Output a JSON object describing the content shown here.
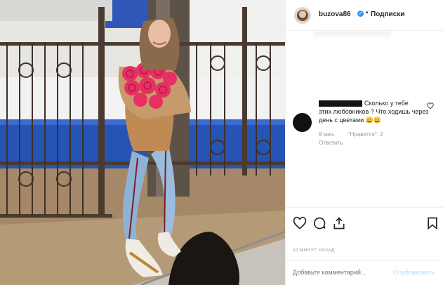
{
  "header": {
    "username": "buzova86",
    "follow_label": "Подписки",
    "separator": "•"
  },
  "comment": {
    "text_line1": "Сколько у тебе",
    "text_rest": "этих любовников ? Что ходишь через день с цветами 😄😄",
    "time": "9 мин.",
    "likes": "\"Нравится\": 2",
    "reply": "Ответить"
  },
  "post": {
    "time_ago": "10 МИНУТ НАЗАД"
  },
  "add_comment": {
    "placeholder": "Добавьте комментарий...",
    "publish_label": "Опубликовать"
  },
  "icons": [
    "heart-icon",
    "comment-icon",
    "share-icon",
    "bookmark-icon",
    "verified-icon"
  ]
}
